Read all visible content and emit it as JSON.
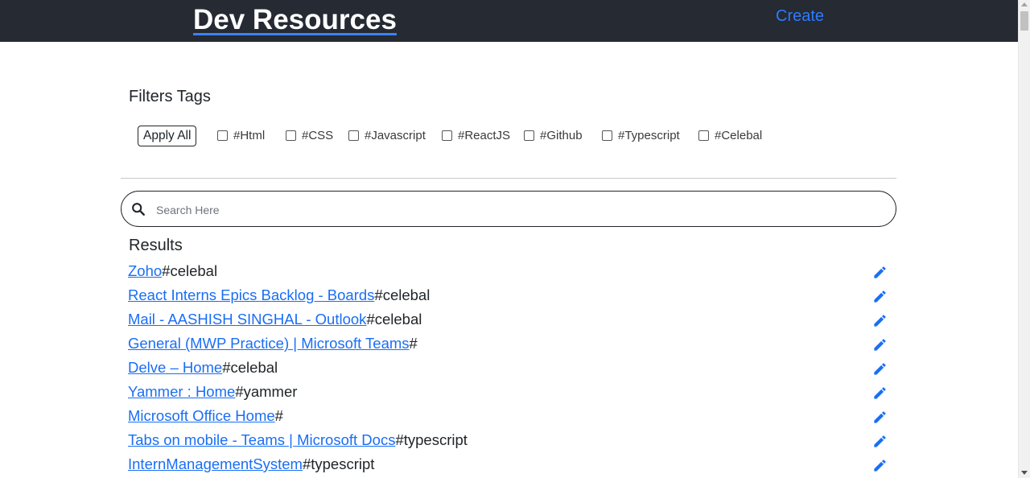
{
  "header": {
    "title": "Dev Resources",
    "create_label": "Create"
  },
  "filters": {
    "title": "Filters Tags",
    "apply_all_label": "Apply All",
    "tags": [
      "#Html",
      "#CSS",
      "#Javascript",
      "#ReactJS",
      "#Github",
      "#Typescript",
      "#Celebal"
    ]
  },
  "search": {
    "placeholder": "Search Here",
    "value": ""
  },
  "results": {
    "title": "Results",
    "items": [
      {
        "link": "Zoho",
        "tag": "#celebal"
      },
      {
        "link": "React Interns Epics Backlog - Boards",
        "tag": "#celebal"
      },
      {
        "link": "Mail - AASHISH SINGHAL - Outlook",
        "tag": "#celebal"
      },
      {
        "link": "General (MWP Practice) | Microsoft Teams",
        "tag": "#"
      },
      {
        "link": "Delve – Home",
        "tag": "#celebal"
      },
      {
        "link": "Yammer : Home",
        "tag": "#yammer"
      },
      {
        "link": "Microsoft Office Home",
        "tag": "#"
      },
      {
        "link": "Tabs on mobile - Teams | Microsoft Docs",
        "tag": "#typescript"
      },
      {
        "link": "InternManagementSystem",
        "tag": "#typescript"
      }
    ]
  },
  "icons": {
    "search": "search-icon",
    "edit": "pencil-icon"
  },
  "colors": {
    "navbar": "#252a33",
    "link": "#1a6ef5",
    "create": "#2f7bff",
    "edit_icon": "#1a6ef5"
  }
}
